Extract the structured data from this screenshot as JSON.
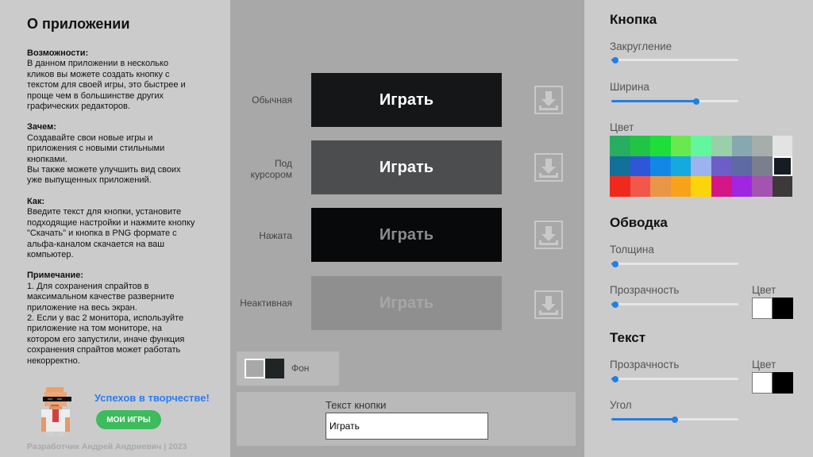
{
  "about": {
    "title": "О приложении",
    "sections": [
      {
        "title": "Возможности:",
        "body": "В данном приложении в несколько\nкликов вы можете создать кнопку с\nтекстом для своей игры, это быстрее и\nпроще чем в большинстве других\nграфических редакторов."
      },
      {
        "title": "Зачем:",
        "body": "Создавайте свои новые игры и\nприложения с новыми стильными\nкнопками.\nВы также можете улучшить вид своих\nуже выпущенных приложений."
      },
      {
        "title": "Как:",
        "body": "Введите текст для кнопки, установите\nподходящие настройки и нажмите кнопку\n\"Скачать\" и кнопка в PNG формате с\nальфа-каналом скачается на ваш\nкомпьютер."
      },
      {
        "title": "Примечание:",
        "body": "1. Для сохранения спрайтов в\nмаксимальном качестве разверните\nприложение на весь экран.\n2. Если у вас 2 монитора, используйте\nприложение на том мониторе, на\nкотором его запустили, иначе функция\nсохранения спрайтов может работать\nнекорректно."
      }
    ],
    "wish": "Успехов в творчестве!",
    "games_button": "МОИ ИГРЫ",
    "footer": "Разработчик Андрей Андриевич | 2023"
  },
  "preview": {
    "button_text": "Играть",
    "states": [
      {
        "label": "Обычная",
        "bg": "#151617",
        "fg": "#ffffff"
      },
      {
        "label": "Под\nкурсором",
        "bg": "#4c4d4e",
        "fg": "#ffffff"
      },
      {
        "label": "Нажата",
        "bg": "#08090a",
        "fg": "#8b8b8b"
      },
      {
        "label": "Неактивная",
        "bg": "#8f8f8f",
        "fg": "#a6a6a6"
      }
    ],
    "download_icon": "download-icon",
    "background_label": "Фон",
    "text_field_label": "Текст кнопки",
    "text_field_value": "Играть"
  },
  "settings": {
    "button_heading": "Кнопка",
    "rounding_label": "Закругление",
    "rounding_value": 0.03,
    "width_label": "Ширина",
    "width_value": 0.67,
    "color_label": "Цвет",
    "palette": [
      "#27ae60",
      "#20c546",
      "#1fde3a",
      "#6ae84f",
      "#62f79d",
      "#99cfa9",
      "#86a8ae",
      "#a6aeac",
      "#e3e3e3",
      "#12709b",
      "#2f56d9",
      "#1387e8",
      "#15a9e0",
      "#9cb3ef",
      "#6d5ec7",
      "#5d6aa3",
      "#7b7f8d",
      "#151d22",
      "#f0291d",
      "#f2574a",
      "#eb9549",
      "#f8a21a",
      "#fbd40b",
      "#d51687",
      "#a126e1",
      "#a453b1",
      "#3d3839"
    ],
    "selected_color_index": 17,
    "outline_heading": "Обводка",
    "thickness_label": "Толщина",
    "thickness_value": 0.03,
    "outline_opacity_label": "Прозрачность",
    "outline_opacity_value": 0.03,
    "outline_color_label": "Цвет",
    "text_heading": "Текст",
    "text_opacity_label": "Прозрачность",
    "text_opacity_value": 0.03,
    "text_color_label": "Цвет",
    "angle_label": "Угол",
    "angle_value": 0.5
  }
}
